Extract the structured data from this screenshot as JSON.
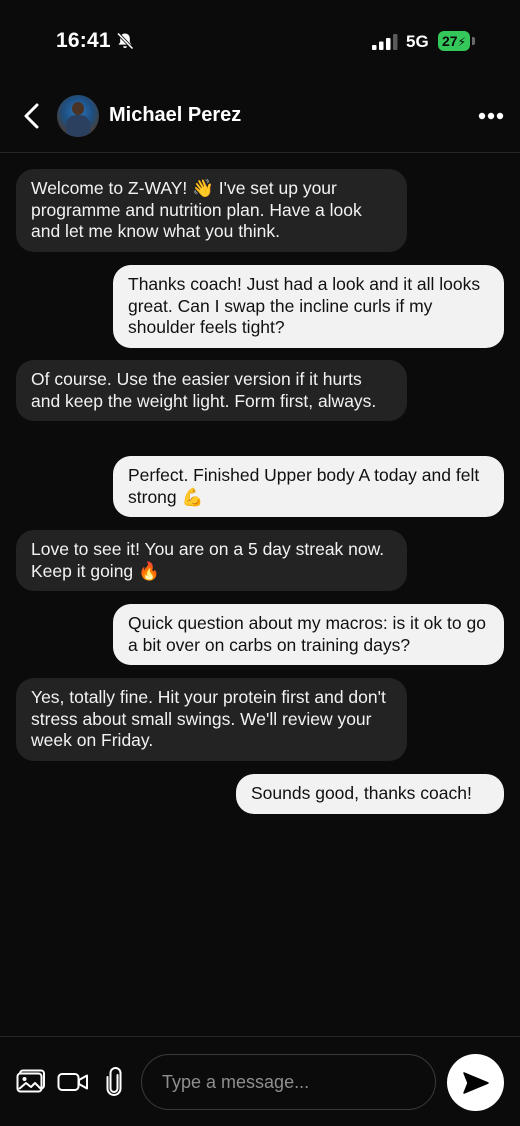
{
  "status_bar": {
    "time": "16:41",
    "network": "5G",
    "battery": "27",
    "icons": [
      "bell-slash-icon",
      "signal-icon",
      "battery-charging-icon"
    ]
  },
  "header": {
    "contact_name": "Michael Perez",
    "icons": [
      "chevron-left-icon",
      "avatar",
      "more-icon"
    ]
  },
  "messages": [
    {
      "direction": "incoming",
      "text": "Welcome to Z-WAY! 👋 I've set up your programme and nutrition plan. Have a look and let me know what you think."
    },
    {
      "direction": "outgoing",
      "text": "Thanks coach! Just had a look and it all looks great. Can I swap the incline curls if my shoulder feels tight?"
    },
    {
      "direction": "incoming",
      "text": "Of course. Use the easier version if it hurts and keep the weight light. Form first, always."
    },
    {
      "direction": "outgoing",
      "text": "Perfect. Finished Upper body A today and felt strong 💪"
    },
    {
      "direction": "incoming",
      "text": "Love to see it! You are on a 5 day streak now. Keep it going 🔥"
    },
    {
      "direction": "outgoing",
      "text": "Quick question about my macros: is it ok to go a bit over on carbs on training days?"
    },
    {
      "direction": "incoming",
      "text": "Yes, totally fine. Hit your protein first and don't stress about small swings. We'll review your week on Friday."
    },
    {
      "direction": "outgoing",
      "text": "Sounds good, thanks coach!"
    }
  ],
  "composer": {
    "placeholder": "Type a message...",
    "value": "",
    "icons": [
      "image-icon",
      "video-icon",
      "paperclip-icon",
      "send-icon"
    ]
  },
  "colors": {
    "background": "#0b0b0b",
    "incoming_bubble": "#232323",
    "outgoing_bubble": "#f2f2f2",
    "battery": "#34c759"
  }
}
